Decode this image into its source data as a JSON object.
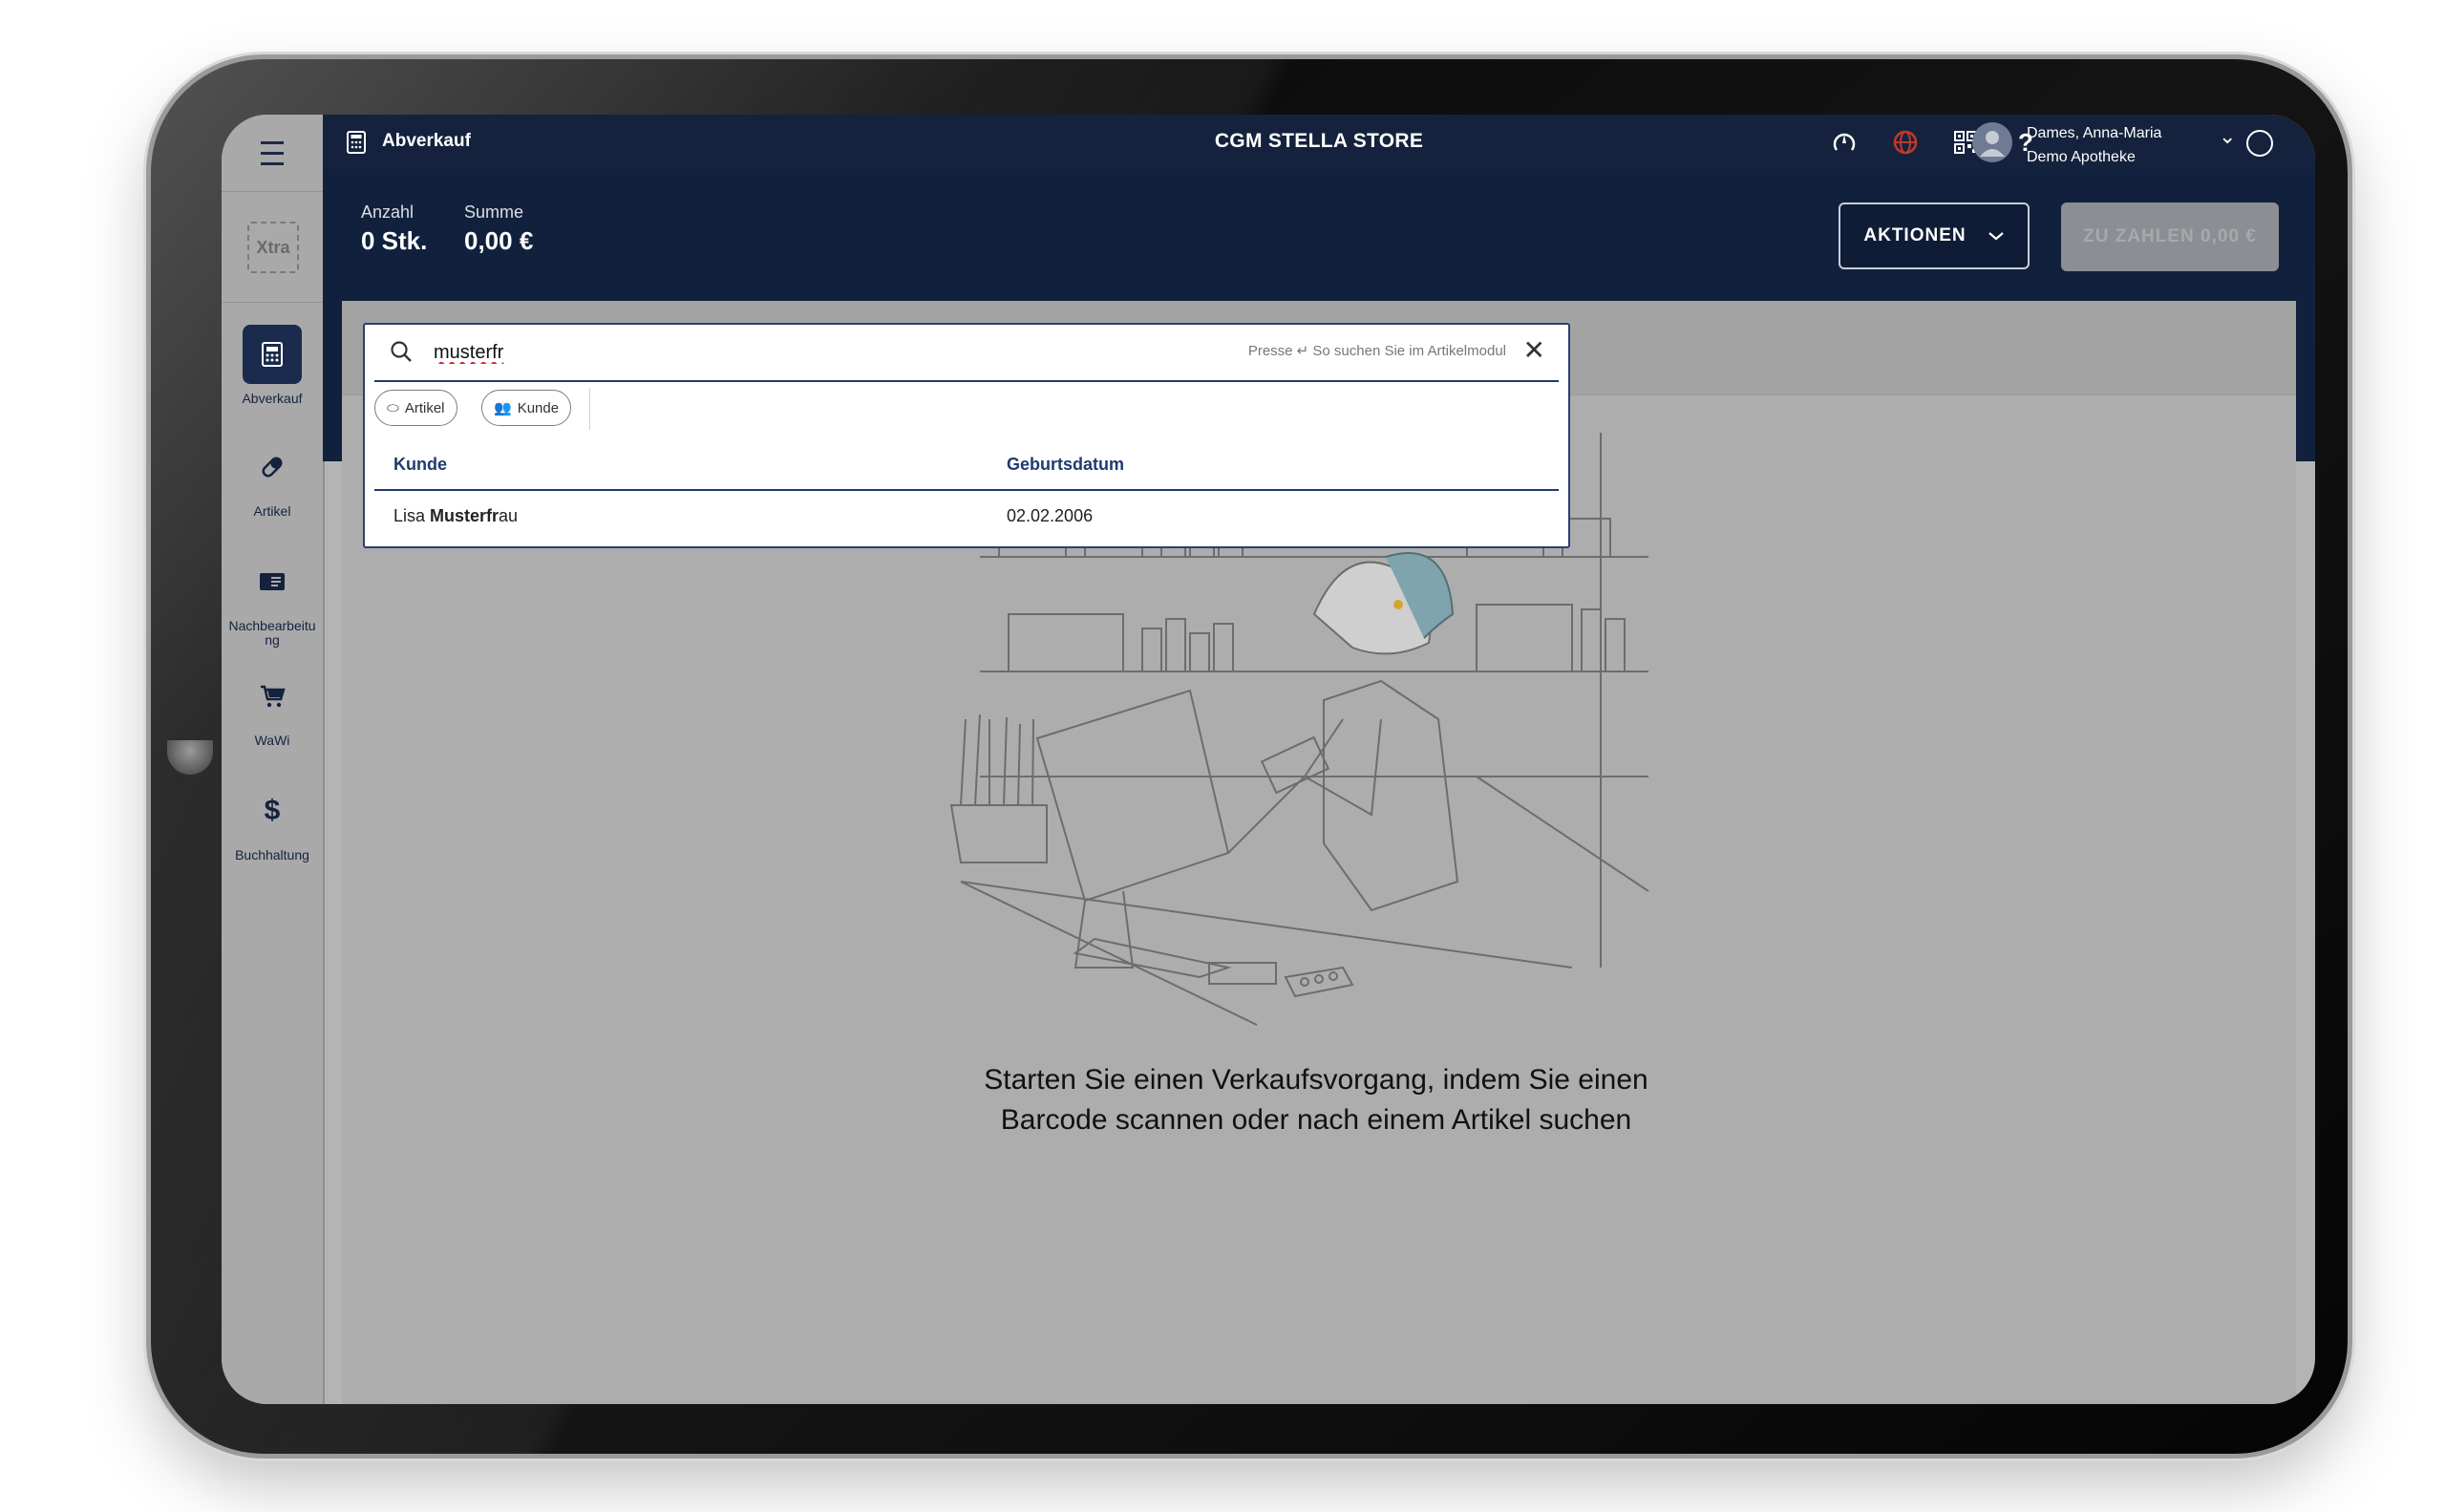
{
  "app": {
    "module_title": "Abverkauf",
    "store_name": "CGM STELLA STORE",
    "user": {
      "name": "Dames, Anna-Maria",
      "pharmacy": "Demo Apotheke"
    }
  },
  "sidebar": {
    "logo": "Xtra",
    "items": [
      {
        "label": "Abverkauf",
        "icon": "cash-register-icon",
        "active": true
      },
      {
        "label": "Artikel",
        "icon": "pill-icon",
        "active": false
      },
      {
        "label": "Nachbearbeitu ng",
        "icon": "postprocessing-icon",
        "active": false
      },
      {
        "label": "WaWi",
        "icon": "cart-icon",
        "active": false
      },
      {
        "label": "Buchhaltung",
        "icon": "dollar-icon",
        "active": false
      }
    ]
  },
  "header": {
    "count_label": "Anzahl",
    "count_value": "0 Stk.",
    "sum_label": "Summe",
    "sum_value": "0,00 €",
    "actions_label": "AKTIONEN",
    "pay_label": "ZU ZAHLEN 0,00 €"
  },
  "search": {
    "value": "musterfr",
    "hint": "Presse ↵ So suchen Sie im Artikelmodul",
    "filters": [
      "Artikel",
      "Kunde"
    ],
    "columns": [
      "Kunde",
      "Geburtsdatum"
    ],
    "results": [
      {
        "first": "Lisa ",
        "match": "Musterfr",
        "rest": "au",
        "birthdate": "02.02.2006"
      }
    ]
  },
  "empty_state": {
    "message": "Starten Sie einen Verkaufsvorgang, indem Sie einen Barcode scannen oder nach einem Artikel suchen"
  },
  "colors": {
    "primary": "#14223d",
    "accent": "#1f3a70",
    "overlay_gray": "#adadad",
    "globe_red": "#c0392b"
  }
}
